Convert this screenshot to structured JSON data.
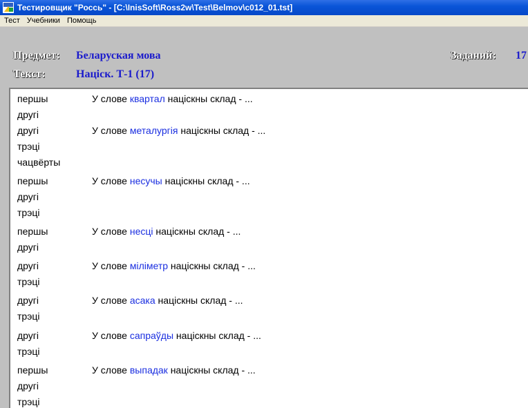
{
  "window": {
    "title": "Тестировщик \"Россь\" - [C:\\InisSoft\\Ross2w\\Test\\Belmov\\c012_01.tst]",
    "icon": "ross-app-icon"
  },
  "menu": {
    "items": [
      "Тест",
      "Учебники",
      "Помощь"
    ]
  },
  "info": {
    "subject_label": "Предмет:",
    "subject_value": "Беларуская мова",
    "tasks_label": "Заданий:",
    "tasks_value": "17",
    "text_label": "Текст:",
    "text_value": "Націск. Т-1 (17)"
  },
  "answers": [
    "першы",
    "другі",
    "другі",
    "трэці",
    "чацвёрты",
    "першы",
    "другі",
    "трэці",
    "першы",
    "другі",
    "другі",
    "трэці",
    "другі",
    "трэці",
    "другі",
    "трэці",
    "першы",
    "другі",
    "трэці"
  ],
  "questions": [
    {
      "prefix": "У слове",
      "word": "квартал",
      "suffix": "націскны склад - ..."
    },
    {
      "prefix": "У слове",
      "word": "металургія",
      "suffix": "націскны склад - ..."
    },
    {
      "prefix": "У слове",
      "word": "несучы",
      "suffix": "націскны склад - ..."
    },
    {
      "prefix": "У слове",
      "word": "несці",
      "suffix": "націскны склад - ..."
    },
    {
      "prefix": "У слове",
      "word": "міліметр",
      "suffix": "націскны склад - ..."
    },
    {
      "prefix": "У слове",
      "word": "асака",
      "suffix": "націскны склад - ..."
    },
    {
      "prefix": "У слове",
      "word": "сапраўды",
      "suffix": "націскны склад - ..."
    },
    {
      "prefix": "У слове",
      "word": "выпадак",
      "suffix": "націскны склад - ..."
    }
  ],
  "colors": {
    "keyword": "#1a2ee0",
    "titlebar": "#0a55d8"
  }
}
